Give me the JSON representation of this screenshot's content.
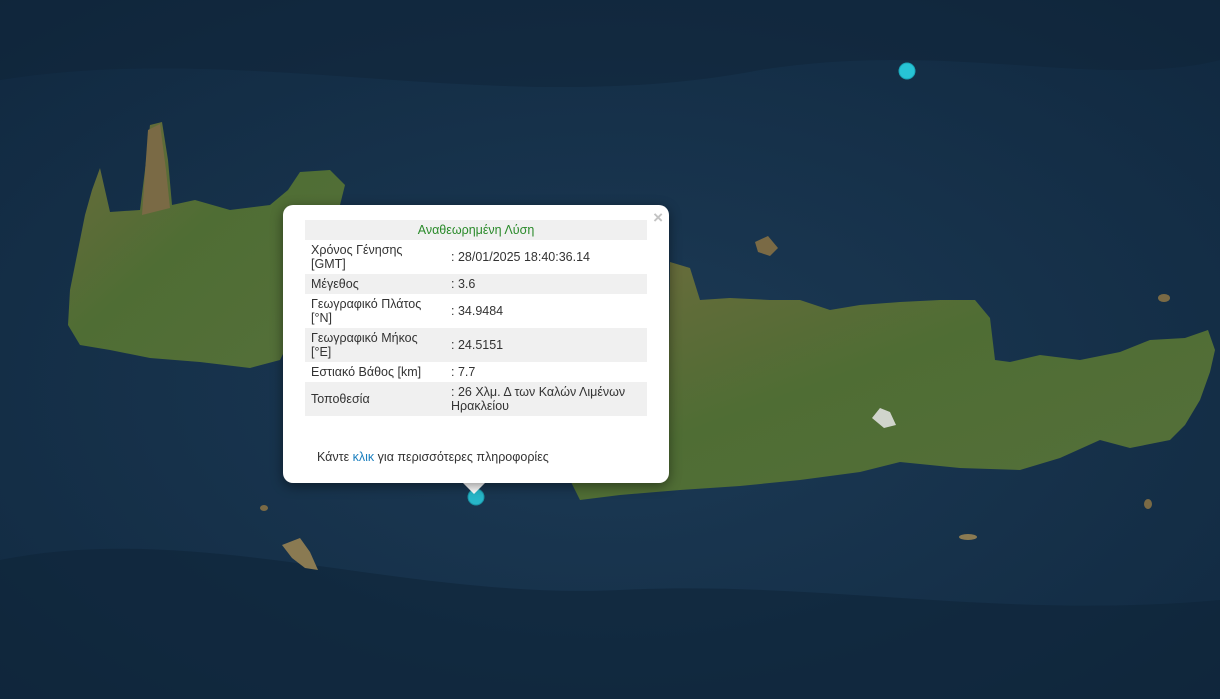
{
  "map": {
    "type": "satellite",
    "colors": {
      "sea": "#14304a",
      "land": "#4a6b32",
      "marker": "#27c4d6"
    },
    "markers": [
      {
        "name": "earthquake-epicenter-selected",
        "icon": "circle-marker"
      },
      {
        "name": "earthquake-epicenter-north",
        "icon": "circle-marker"
      }
    ]
  },
  "popup": {
    "close_icon": "×",
    "title": "Αναθεωρημένη Λύση",
    "rows": [
      {
        "label": "Χρόνος Γένησης [GMT]",
        "value": ": 28/01/2025 18:40:36.14"
      },
      {
        "label": "Μέγεθος",
        "value": ": 3.6"
      },
      {
        "label": "Γεωγραφικό Πλάτος [°N]",
        "value": ": 34.9484"
      },
      {
        "label": "Γεωγραφικό Μήκος [°E]",
        "value": ": 24.5151"
      },
      {
        "label": "Εστιακό Βάθος [km]",
        "value": ": 7.7"
      },
      {
        "label": "Τοποθεσία",
        "value": ": 26 Χλμ. Δ των Καλών Λιμένων Ηρακλείου"
      }
    ],
    "footer": {
      "before": "Κάντε ",
      "link": "κλικ",
      "after": " για περισσότερες πληροφορίες"
    }
  }
}
